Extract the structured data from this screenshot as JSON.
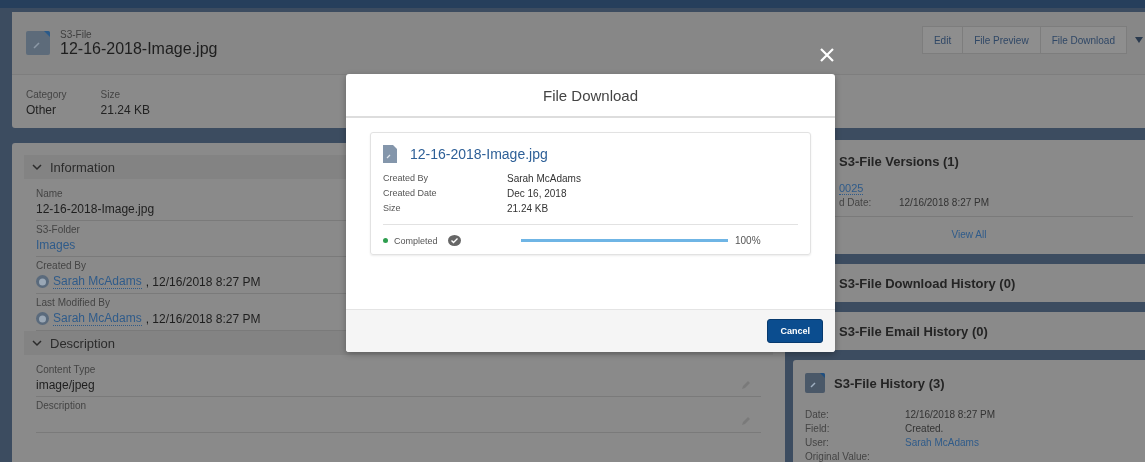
{
  "header": {
    "object_type": "S3-File",
    "title": "12-16-2018-Image.jpg",
    "actions": [
      "Edit",
      "File Preview",
      "File Download"
    ],
    "fields": [
      {
        "label": "Category",
        "value": "Other"
      },
      {
        "label": "Size",
        "value": "21.24 KB"
      }
    ]
  },
  "details": {
    "sections": [
      {
        "title": "Information",
        "expanded": true,
        "fields": [
          {
            "label": "Name",
            "value": "12-16-2018-Image.jpg",
            "kind": "text"
          },
          {
            "label": "S3-Folder",
            "value": "Images",
            "kind": "link"
          },
          {
            "label": "Created By",
            "value": "Sarah McAdams",
            "suffix": ", 12/16/2018 8:27 PM",
            "kind": "user"
          },
          {
            "label": "Last Modified By",
            "value": "Sarah McAdams",
            "suffix": ", 12/16/2018 8:27 PM",
            "kind": "user"
          }
        ]
      },
      {
        "title": "Description",
        "expanded": true,
        "fields": [
          {
            "label": "Content Type",
            "value": "image/jpeg",
            "kind": "text",
            "editable": true
          },
          {
            "label": "Description",
            "kind": "text",
            "editable": true
          }
        ]
      }
    ]
  },
  "related": [
    {
      "kind": "list",
      "title": "S3-File Versions (1)",
      "items": [
        {
          "name": "0025",
          "date_label": "d Date:",
          "date": "12/16/2018 8:27 PM"
        }
      ],
      "footer": "View All"
    },
    {
      "kind": "empty",
      "title": "S3-File Download History (0)"
    },
    {
      "kind": "empty",
      "title": "S3-File Email History (0)"
    },
    {
      "kind": "history",
      "title": "S3-File History (3)",
      "rows": [
        {
          "label": "Date:",
          "value": "12/16/2018 8:27 PM",
          "kind": "text"
        },
        {
          "label": "Field:",
          "value": "Created.",
          "kind": "text"
        },
        {
          "label": "User:",
          "value": "Sarah McAdams",
          "kind": "link"
        },
        {
          "label": "Original Value:",
          "kind": "text"
        }
      ]
    }
  ],
  "modal": {
    "title": "File Download",
    "file": {
      "name": "12-16-2018-Image.jpg",
      "fields": [
        {
          "label": "Created By",
          "value": "Sarah McAdams"
        },
        {
          "label": "Created Date",
          "value": "Dec 16, 2018"
        },
        {
          "label": "Size",
          "value": "21.24 KB"
        }
      ]
    },
    "status": {
      "label": "Completed",
      "completed": true
    },
    "level": 1,
    "reading": "100%",
    "buttons": [
      "Cancel"
    ]
  }
}
